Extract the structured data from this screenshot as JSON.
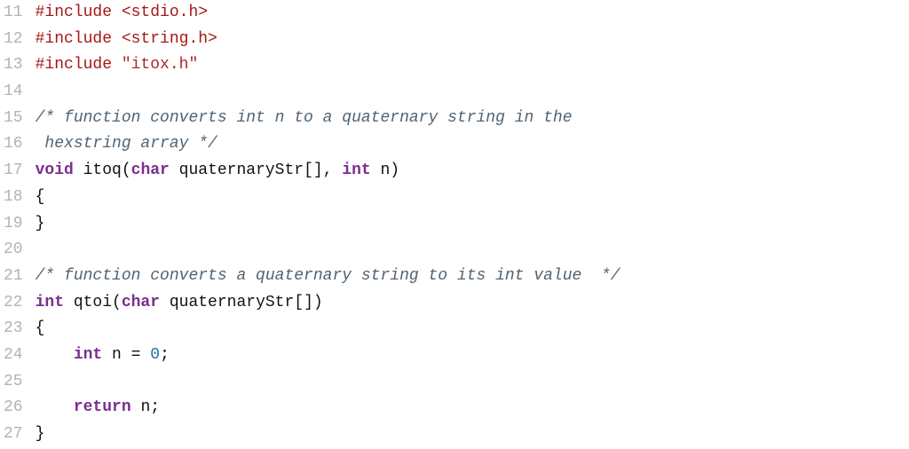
{
  "code": {
    "lines": [
      {
        "num": "11",
        "tokens": [
          {
            "cls": "pp-directive",
            "t": "#include "
          },
          {
            "cls": "pp-include-sys",
            "t": "<stdio.h>"
          }
        ]
      },
      {
        "num": "12",
        "tokens": [
          {
            "cls": "pp-directive",
            "t": "#include "
          },
          {
            "cls": "pp-include-sys",
            "t": "<string.h>"
          }
        ]
      },
      {
        "num": "13",
        "tokens": [
          {
            "cls": "pp-directive",
            "t": "#include "
          },
          {
            "cls": "pp-include-local",
            "t": "\"itox.h\""
          }
        ]
      },
      {
        "num": "14",
        "tokens": []
      },
      {
        "num": "15",
        "tokens": [
          {
            "cls": "comment",
            "t": "/* function converts int n to a quaternary string in the"
          }
        ]
      },
      {
        "num": "16",
        "tokens": [
          {
            "cls": "comment",
            "t": " hexstring array */"
          }
        ]
      },
      {
        "num": "17",
        "tokens": [
          {
            "cls": "keyword-type",
            "t": "void"
          },
          {
            "cls": "plain",
            "t": " itoq("
          },
          {
            "cls": "keyword-type",
            "t": "char"
          },
          {
            "cls": "plain",
            "t": " quaternaryStr[], "
          },
          {
            "cls": "keyword-type",
            "t": "int"
          },
          {
            "cls": "plain",
            "t": " n)"
          }
        ]
      },
      {
        "num": "18",
        "tokens": [
          {
            "cls": "punct",
            "t": "{"
          }
        ]
      },
      {
        "num": "19",
        "tokens": [
          {
            "cls": "punct",
            "t": "}"
          }
        ]
      },
      {
        "num": "20",
        "tokens": []
      },
      {
        "num": "21",
        "tokens": [
          {
            "cls": "comment",
            "t": "/* function converts a quaternary string to its int value  */"
          }
        ]
      },
      {
        "num": "22",
        "tokens": [
          {
            "cls": "keyword-type",
            "t": "int"
          },
          {
            "cls": "plain",
            "t": " qtoi("
          },
          {
            "cls": "keyword-type",
            "t": "char"
          },
          {
            "cls": "plain",
            "t": " quaternaryStr[])"
          }
        ]
      },
      {
        "num": "23",
        "tokens": [
          {
            "cls": "punct",
            "t": "{"
          }
        ]
      },
      {
        "num": "24",
        "tokens": [
          {
            "cls": "plain",
            "t": "    "
          },
          {
            "cls": "keyword-type",
            "t": "int"
          },
          {
            "cls": "plain",
            "t": " n = "
          },
          {
            "cls": "number",
            "t": "0"
          },
          {
            "cls": "punct",
            "t": ";"
          }
        ]
      },
      {
        "num": "25",
        "tokens": []
      },
      {
        "num": "26",
        "tokens": [
          {
            "cls": "plain",
            "t": "    "
          },
          {
            "cls": "keyword-ctrl",
            "t": "return"
          },
          {
            "cls": "plain",
            "t": " n;"
          }
        ]
      },
      {
        "num": "27",
        "tokens": [
          {
            "cls": "punct",
            "t": "}"
          }
        ]
      }
    ]
  }
}
